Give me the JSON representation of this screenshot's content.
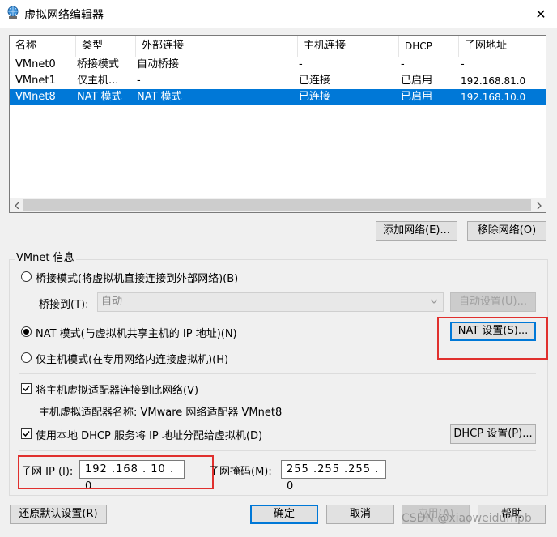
{
  "window": {
    "title": "虚拟网络编辑器",
    "close_glyph": "✕"
  },
  "table": {
    "columns": [
      "名称",
      "类型",
      "外部连接",
      "主机连接",
      "DHCP",
      "子网地址"
    ],
    "rows": [
      [
        "VMnet0",
        "桥接模式",
        "自动桥接",
        "-",
        "-",
        "-"
      ],
      [
        "VMnet1",
        "仅主机...",
        "-",
        "已连接",
        "已启用",
        "192.168.81.0"
      ],
      [
        "VMnet8",
        "NAT 模式",
        "NAT 模式",
        "已连接",
        "已启用",
        "192.168.10.0"
      ]
    ],
    "selected_row": 2
  },
  "buttons": {
    "add_network": "添加网络(E)...",
    "remove_network": "移除网络(O)",
    "auto_settings": "自动设置(U)...",
    "nat_settings": "NAT 设置(S)...",
    "dhcp_settings": "DHCP 设置(P)...",
    "restore_defaults": "还原默认设置(R)",
    "ok": "确定",
    "cancel": "取消",
    "apply": "应用(A)",
    "help": "帮助"
  },
  "vmnet_info": {
    "title": "VMnet 信息",
    "bridged_label": "桥接模式(将虚拟机直接连接到外部网络)(B)",
    "bridged_to_label": "桥接到(T):",
    "bridged_to_value": "自动",
    "nat_label": "NAT 模式(与虚拟机共享主机的 IP 地址)(N)",
    "hostonly_label": "仅主机模式(在专用网络内连接虚拟机)(H)",
    "selected_mode": "nat",
    "connect_adapter_label": "将主机虚拟适配器连接到此网络(V)",
    "connect_adapter_checked": true,
    "adapter_name_text": "主机虚拟适配器名称: VMware 网络适配器 VMnet8",
    "dhcp_label": "使用本地 DHCP 服务将 IP 地址分配给虚拟机(D)",
    "dhcp_checked": true,
    "subnet_ip_label": "子网 IP (I):",
    "subnet_ip_value": "192 .168 . 10 . 0",
    "subnet_mask_label": "子网掩码(M):",
    "subnet_mask_value": "255 .255 .255 . 0"
  },
  "watermark": "CSDN @xiaoweidumpb",
  "colors": {
    "selection": "#0078d7",
    "highlight_box": "#e0302e"
  }
}
